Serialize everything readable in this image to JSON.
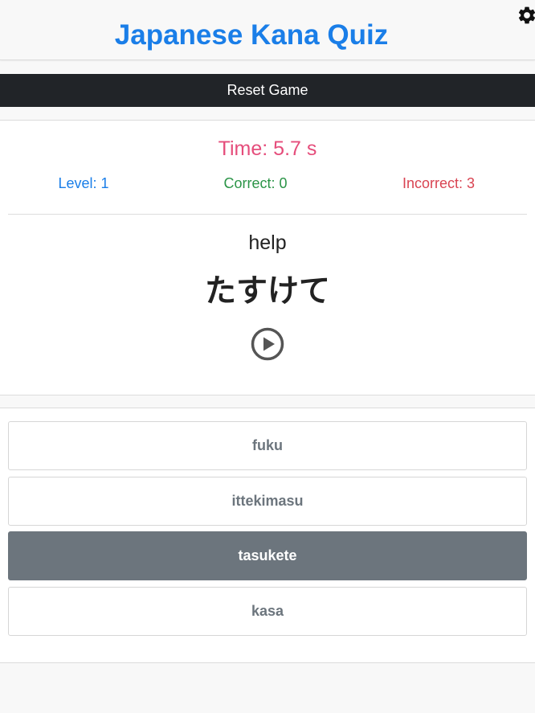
{
  "header": {
    "title": "Japanese Kana Quiz",
    "settings_icon": "gear-icon"
  },
  "controls": {
    "reset_label": "Reset Game"
  },
  "quiz": {
    "timer": "Time: 5.7 s",
    "level": "Level: 1",
    "correct": "Correct: 0",
    "incorrect": "Incorrect: 3",
    "meaning": "help",
    "kana": "たすけて",
    "play_icon": "play-circle-icon"
  },
  "answers": [
    {
      "label": "fuku",
      "selected": false
    },
    {
      "label": "ittekimasu",
      "selected": false
    },
    {
      "label": "tasukete",
      "selected": true
    },
    {
      "label": "kasa",
      "selected": false
    }
  ],
  "colors": {
    "title": "#1a7ee8",
    "timer": "#e54d7b",
    "level": "#1a7ee8",
    "correct": "#2b9447",
    "incorrect": "#d94452",
    "reset_bar": "#212428",
    "selected_answer": "#6c757d"
  }
}
